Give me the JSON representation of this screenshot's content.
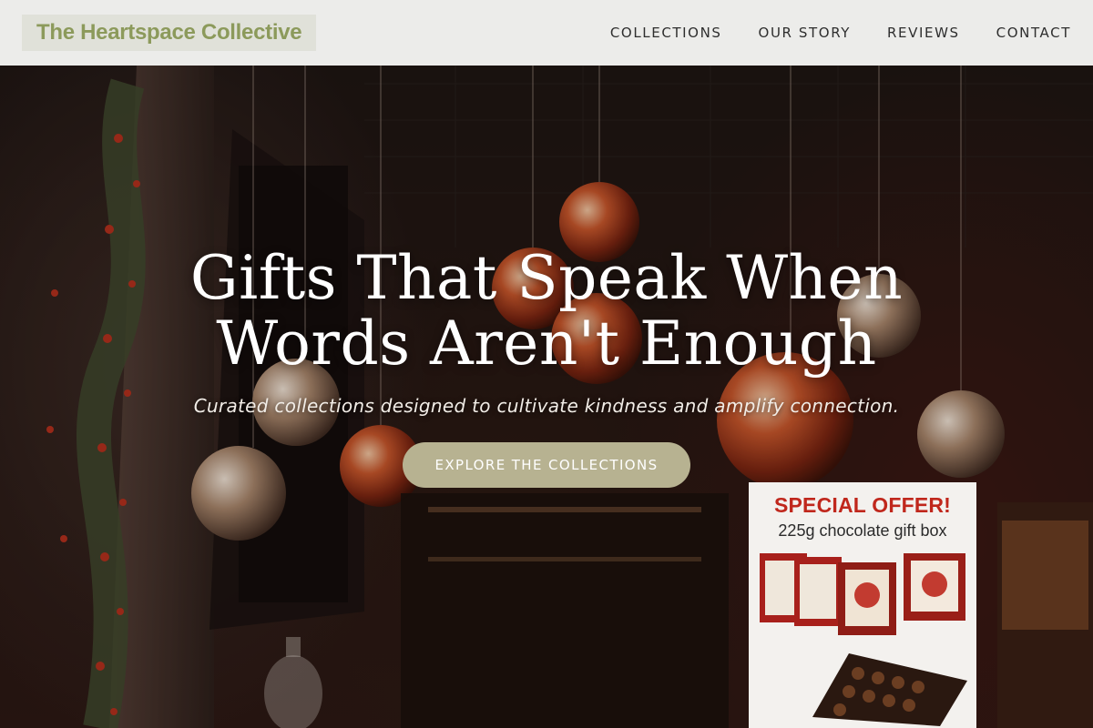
{
  "header": {
    "logo": "The Heartspace Collective",
    "nav": [
      {
        "label": "COLLECTIONS"
      },
      {
        "label": "OUR STORY"
      },
      {
        "label": "REVIEWS"
      },
      {
        "label": "CONTACT"
      }
    ]
  },
  "hero": {
    "title_line1": "Gifts That Speak When",
    "title_line2": "Words Aren't Enough",
    "subtitle": "Curated collections designed to cultivate kindness and amplify connection.",
    "cta_label": "EXPLORE THE COLLECTIONS",
    "background_image": {
      "shop_sign_title": "SPECIAL OFFER!",
      "shop_sign_subtitle": "225g chocolate gift box"
    }
  },
  "colors": {
    "header_bg": "#ececea",
    "logo_text": "#8c9a5b",
    "cta_bg": "#b7b291",
    "ornament": "#c24a24",
    "promo_red": "#c0271c"
  }
}
